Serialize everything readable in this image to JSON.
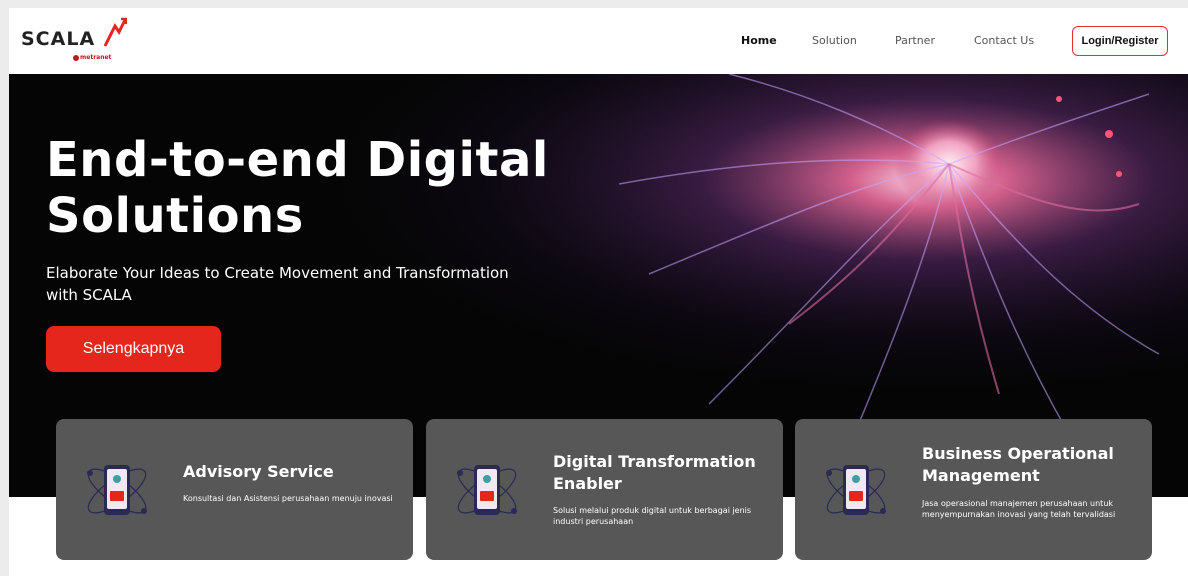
{
  "brand": {
    "logo_text": "SCALA",
    "logo_sub": "metranet"
  },
  "nav": {
    "items": [
      {
        "label": "Home"
      },
      {
        "label": "Solution"
      },
      {
        "label": "Partner"
      },
      {
        "label": "Contact Us"
      }
    ],
    "login_label": "Login/Register"
  },
  "hero": {
    "title_line1": "End-to-end Digital",
    "title_line2": "Solutions",
    "subtitle_line1": "Elaborate Your Ideas to Create Movement and Transformation",
    "subtitle_line2": "with SCALA",
    "cta_label": "Selengkapnya"
  },
  "cards": [
    {
      "title": "Advisory Service",
      "desc": "Konsultasi dan Asistensi perusahaan menuju inovasi",
      "icon": "phone-atom-icon"
    },
    {
      "title": "Digital Transformation Enabler",
      "desc": "Solusi melalui produk digital untuk berbagai jenis industri perusahaan",
      "icon": "phone-atom-icon"
    },
    {
      "title": "Business Operational Management",
      "desc": "Jasa operasional manajemen perusahaan untuk menyempurnakan inovasi yang telah tervalidasi",
      "icon": "phone-atom-icon"
    }
  ],
  "colors": {
    "accent": "#e4261d",
    "card_bg": "#575757",
    "hero_bg": "#050505"
  }
}
